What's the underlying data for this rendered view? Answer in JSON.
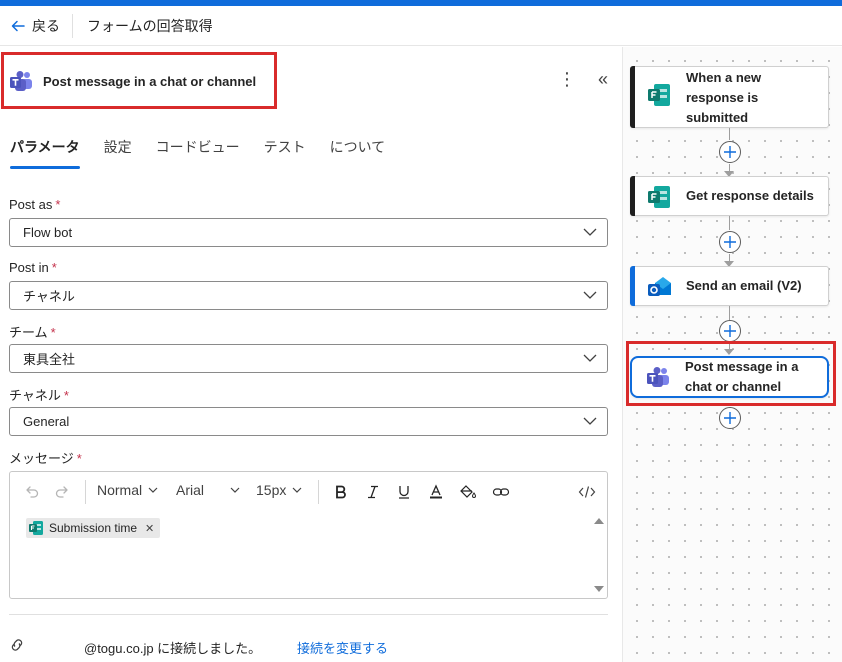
{
  "header": {
    "back_label": "戻る",
    "flow_title": "フォームの回答取得"
  },
  "panel": {
    "title": "Post message in a chat or channel",
    "more_glyph": "⋮",
    "collapse_glyph": "«",
    "tabs": [
      {
        "label": "パラメータ",
        "active": true
      },
      {
        "label": "設定",
        "active": false
      },
      {
        "label": "コードビュー",
        "active": false
      },
      {
        "label": "テスト",
        "active": false
      },
      {
        "label": "について",
        "active": false
      }
    ],
    "fields": {
      "post_as": {
        "label": "Post as",
        "required": "*",
        "value": "Flow bot"
      },
      "post_in": {
        "label": "Post in",
        "required": "*",
        "value": "チャネル"
      },
      "team": {
        "label": "チーム",
        "required": "*",
        "value": "東具全社"
      },
      "channel": {
        "label": "チャネル",
        "required": "*",
        "value": "General"
      },
      "message": {
        "label": "メッセージ",
        "required": "*"
      }
    },
    "editor": {
      "style_value": "Normal",
      "font_value": "Arial",
      "size_value": "15px",
      "token_label": "Submission time",
      "token_remove": "✕"
    },
    "connection": {
      "text": "@togu.co.jp に接続しました。",
      "change_link": "接続を変更する"
    }
  },
  "canvas": {
    "steps": [
      {
        "label_lines": [
          "When a new",
          "response is",
          "submitted"
        ],
        "service": "forms-icon",
        "accent": "#1f1f1f"
      },
      {
        "label_lines": [
          "Get response details"
        ],
        "service": "forms-icon",
        "accent": "#1f1f1f"
      },
      {
        "label_lines": [
          "Send an email (V2)"
        ],
        "service": "outlook-icon",
        "accent": "#0f6cdb"
      },
      {
        "label_lines": [
          "Post message in a",
          "chat or channel"
        ],
        "service": "teams-icon",
        "accent": "#0f6cdb",
        "selected": true
      }
    ]
  },
  "colors": {
    "accent": "#0f6cdb",
    "highlight": "#d92b2b",
    "required": "#c4314b",
    "forms_green": "#0e7a6e",
    "teams_purple": "#5b5fc7"
  }
}
